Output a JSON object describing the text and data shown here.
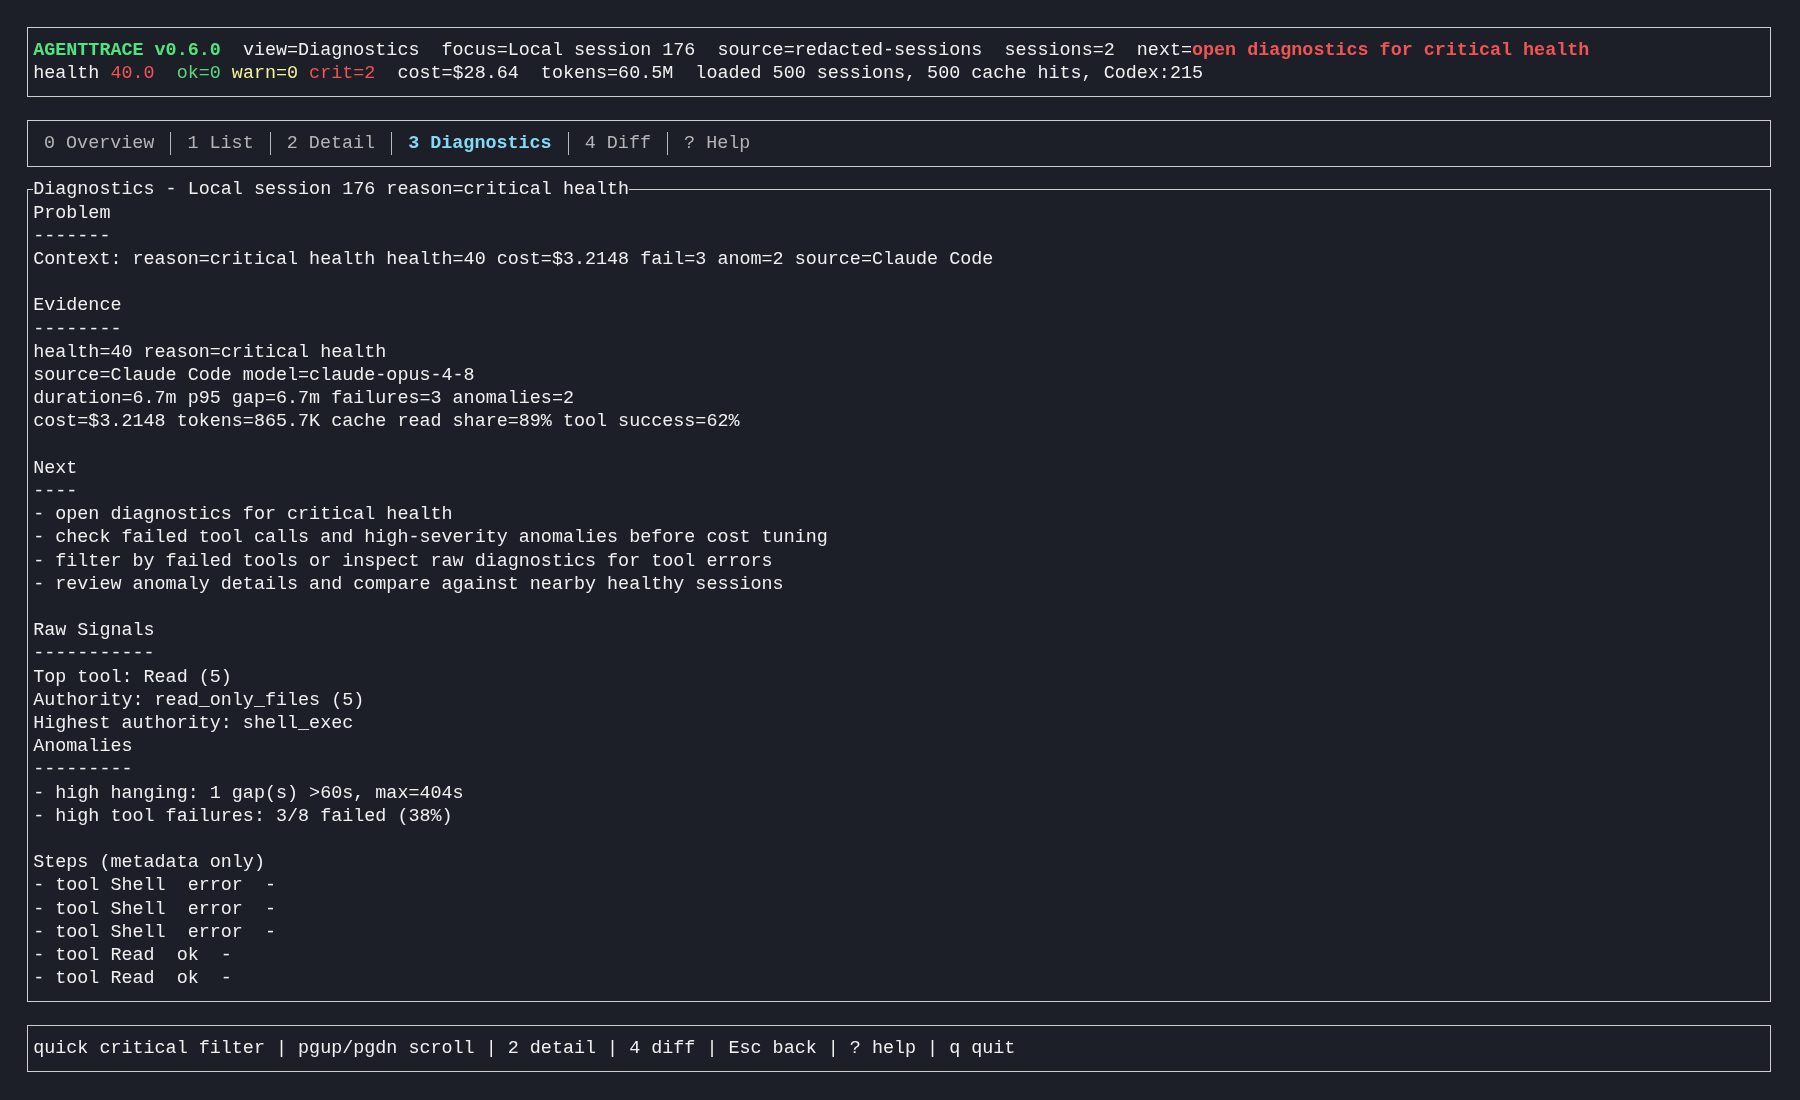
{
  "header": {
    "title": "AGENTTRACE v0.6.0",
    "fields": [
      "view=Diagnostics",
      "focus=Local session 176",
      "source=redacted-sessions",
      "sessions=2"
    ],
    "next": {
      "label": "next=",
      "value": "open diagnostics for critical health"
    },
    "stats": [
      {
        "items": [
          {
            "text": "health",
            "color": "#f0f0f0"
          },
          {
            "text": "40.0",
            "color": "#f05454"
          }
        ]
      },
      {
        "items": [
          {
            "text": "ok=0",
            "color": "#5cd67c"
          },
          {
            "text": "warn=0",
            "color": "#f2f29c"
          },
          {
            "text": "crit=2",
            "color": "#f05454"
          }
        ]
      },
      {
        "items": [
          {
            "text": "cost=$28.64",
            "color": "#f0f0f0"
          }
        ]
      },
      {
        "items": [
          {
            "text": "tokens=60.5M",
            "color": "#f0f0f0"
          }
        ]
      },
      {
        "items": [
          {
            "text": "loaded 500 sessions, 500 cache hits, Codex:215",
            "color": "#f0f0f0"
          }
        ]
      }
    ]
  },
  "tabs": [
    {
      "label": "0 Overview",
      "selected": false
    },
    {
      "label": "1 List",
      "selected": false
    },
    {
      "label": "2 Detail",
      "selected": false
    },
    {
      "label": "3 Diagnostics",
      "selected": true
    },
    {
      "label": "4 Diff",
      "selected": false
    },
    {
      "label": "? Help",
      "selected": false
    }
  ],
  "diagnostics": {
    "title": "Diagnostics - Local session 176 reason=critical health",
    "sections": [
      {
        "heading": "Problem",
        "rule": "-------",
        "lines": [
          "Context: reason=critical health health=40 cost=$3.2148 fail=3 anom=2 source=Claude Code"
        ]
      },
      {
        "heading": "Evidence",
        "rule": "--------",
        "lines": [
          "health=40 reason=critical health",
          "source=Claude Code model=claude-opus-4-8",
          "duration=6.7m p95 gap=6.7m failures=3 anomalies=2",
          "cost=$3.2148 tokens=865.7K cache read share=89% tool success=62%"
        ]
      },
      {
        "heading": "Next",
        "rule": "----",
        "lines": [
          "- open diagnostics for critical health",
          "- check failed tool calls and high-severity anomalies before cost tuning",
          "- filter by failed tools or inspect raw diagnostics for tool errors",
          "- review anomaly details and compare against nearby healthy sessions"
        ]
      },
      {
        "heading": "Raw Signals",
        "rule": "-----------",
        "lines": [
          "Top tool: Read (5)",
          "Authority: read_only_files (5)",
          "Highest authority: shell_exec"
        ],
        "subsections": [
          {
            "heading": "Anomalies",
            "rule": "---------",
            "lines": [
              "- high hanging: 1 gap(s) >60s, max=404s",
              "- high tool failures: 3/8 failed (38%)"
            ]
          }
        ]
      },
      {
        "heading": "Steps (metadata only)",
        "lines": [
          "- tool Shell  error  -",
          "- tool Shell  error  -",
          "- tool Shell  error  -",
          "- tool Read  ok  -",
          "- tool Read  ok  -"
        ]
      }
    ]
  },
  "key_hints": "quick critical filter | pgup/pgdn scroll | 2 detail | 4 diff | Esc back | ? help | q quit"
}
